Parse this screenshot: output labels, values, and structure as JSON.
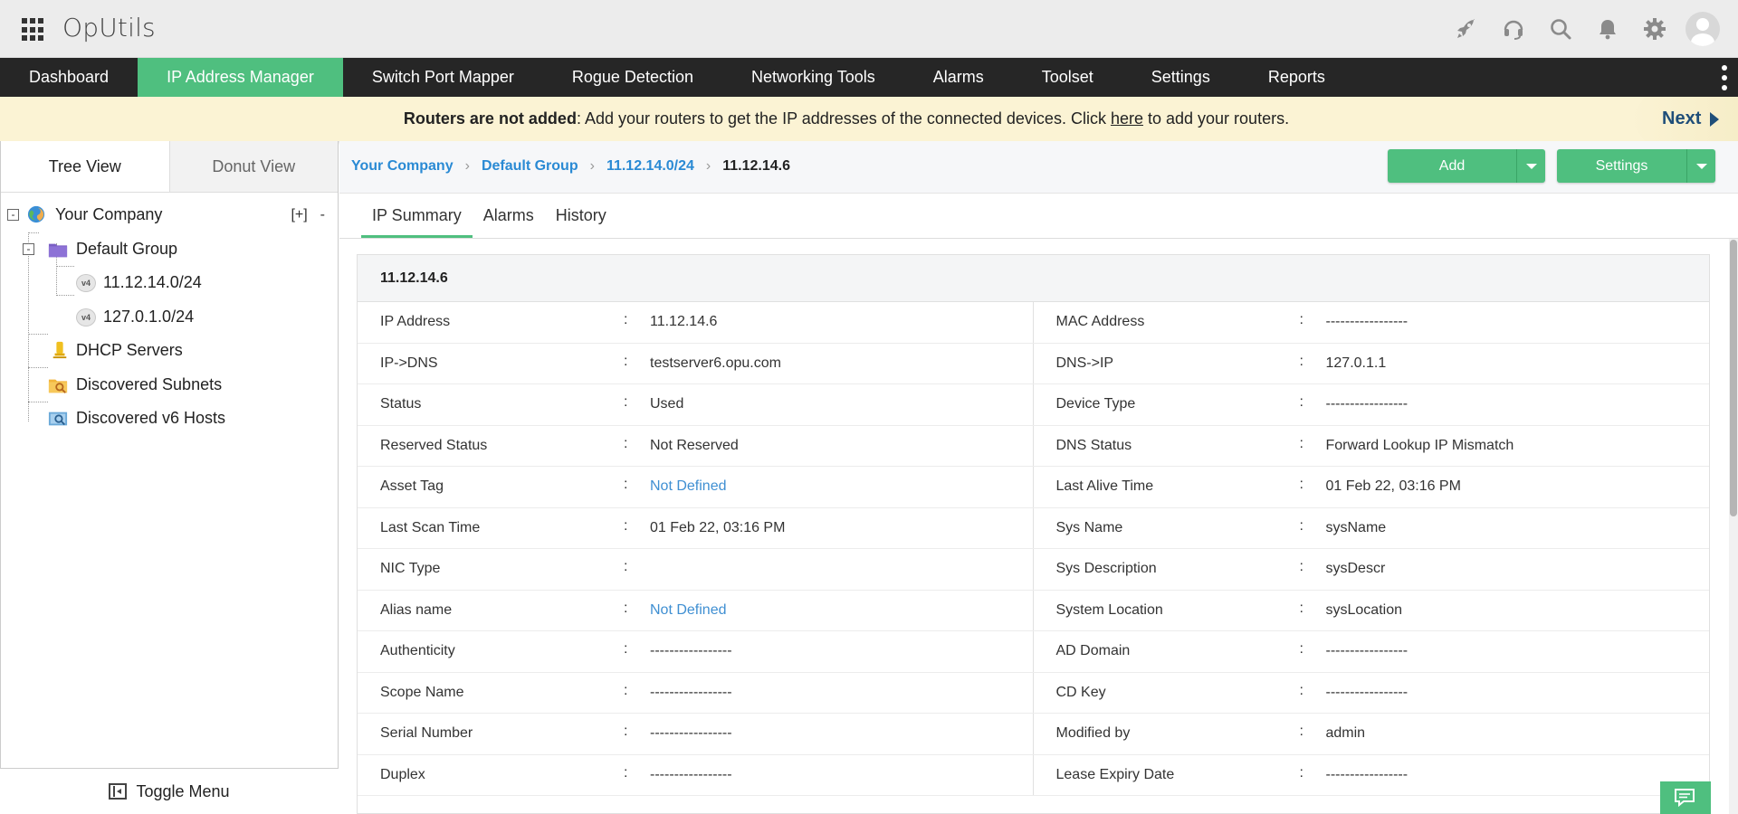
{
  "app": {
    "title": "OpUtils"
  },
  "header": {
    "icons": [
      "rocket-icon",
      "headset-icon",
      "search-icon",
      "bell-icon",
      "gear-icon",
      "avatar"
    ]
  },
  "nav": {
    "items": [
      {
        "label": "Dashboard"
      },
      {
        "label": "IP Address Manager"
      },
      {
        "label": "Switch Port Mapper"
      },
      {
        "label": "Rogue Detection"
      },
      {
        "label": "Networking Tools"
      },
      {
        "label": "Alarms"
      },
      {
        "label": "Toolset"
      },
      {
        "label": "Settings"
      },
      {
        "label": "Reports"
      }
    ],
    "active": "IP Address Manager",
    "active_color": "#4fbf7f"
  },
  "banner": {
    "bold": "Routers are not added",
    "text_before": ": Add your routers to get the IP addresses of the connected devices. Click ",
    "link": "here",
    "text_after": " to add your routers.",
    "next": "Next"
  },
  "left_panel": {
    "tabs": [
      {
        "label": "Tree View"
      },
      {
        "label": "Donut View"
      }
    ],
    "tree": {
      "root": "Your Company",
      "root_actions": [
        "[+]",
        "-"
      ],
      "group": "Default Group",
      "subnets": [
        {
          "badge": "v4",
          "label": "11.12.14.0/24"
        },
        {
          "badge": "v4",
          "label": "127.0.1.0/24"
        }
      ],
      "others": [
        "DHCP Servers",
        "Discovered Subnets",
        "Discovered v6 Hosts"
      ],
      "toggle_symbol": "-"
    },
    "toggle_menu": "Toggle Menu"
  },
  "breadcrumb": [
    "Your Company",
    "Default Group",
    "11.12.14.0/24",
    "11.12.14.6"
  ],
  "buttons": {
    "add": "Add",
    "settings": "Settings"
  },
  "detail_tabs": [
    "IP Summary",
    "Alarms",
    "History"
  ],
  "summary": {
    "title": "11.12.14.6",
    "rows": [
      {
        "l_label": "IP Address",
        "l_val": "11.12.14.6",
        "r_label": "MAC Address",
        "r_val": "-----------------"
      },
      {
        "l_label": "IP->DNS",
        "l_val": "testserver6.opu.com",
        "r_label": "DNS->IP",
        "r_val": "127.0.1.1"
      },
      {
        "l_label": "Status",
        "l_val": "Used",
        "r_label": "Device Type",
        "r_val": "-----------------"
      },
      {
        "l_label": "Reserved Status",
        "l_val": "Not Reserved",
        "r_label": "DNS Status",
        "r_val": "Forward Lookup IP Mismatch"
      },
      {
        "l_label": "Asset Tag",
        "l_val": "Not Defined",
        "l_link": true,
        "r_label": "Last Alive Time",
        "r_val": "01 Feb 22, 03:16 PM"
      },
      {
        "l_label": "Last Scan Time",
        "l_val": "01 Feb 22, 03:16 PM",
        "r_label": "Sys Name",
        "r_val": "sysName"
      },
      {
        "l_label": "NIC Type",
        "l_val": "",
        "r_label": "Sys Description",
        "r_val": "sysDescr"
      },
      {
        "l_label": "Alias name",
        "l_val": "Not Defined",
        "l_link": true,
        "r_label": "System Location",
        "r_val": "sysLocation"
      },
      {
        "l_label": "Authenticity",
        "l_val": "-----------------",
        "r_label": "AD Domain",
        "r_val": "-----------------"
      },
      {
        "l_label": "Scope Name",
        "l_val": "-----------------",
        "r_label": "CD Key",
        "r_val": "-----------------"
      },
      {
        "l_label": "Serial Number",
        "l_val": "-----------------",
        "r_label": "Modified by",
        "r_val": "admin"
      },
      {
        "l_label": "Duplex",
        "l_val": "-----------------",
        "r_label": "Lease Expiry Date",
        "r_val": "-----------------"
      }
    ],
    "colon": ":"
  },
  "colors": {
    "accent": "#4fbf7f",
    "link": "#2a8ad4",
    "nav_bg": "#262626",
    "banner_bg": "#fbf3d4"
  }
}
